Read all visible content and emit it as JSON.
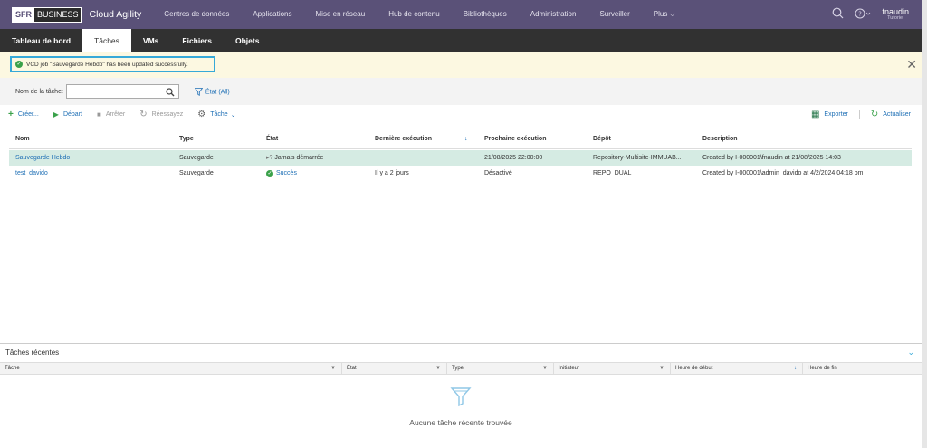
{
  "header": {
    "logo_sfr": "SFR",
    "logo_business": "BUSINESS",
    "app_name": "Cloud Agility",
    "nav": [
      "Centres de données",
      "Applications",
      "Mise en réseau",
      "Hub de contenu",
      "Bibliothèques",
      "Administration",
      "Surveiller",
      "Plus ⌵"
    ],
    "user_name": "fnaudin",
    "user_org": "Tutoriel"
  },
  "tabs": [
    "Tableau de bord",
    "Tâches",
    "VMs",
    "Fichiers",
    "Objets"
  ],
  "notification": {
    "message": "VCD job \"Sauvegarde Hebdo\" has been updated successfully."
  },
  "filter": {
    "label": "Nom de la tâche:",
    "value": "",
    "status": "État (All)"
  },
  "toolbar": {
    "create": "Créer...",
    "start": "Départ",
    "stop": "Arrêter",
    "retry": "Réessayez",
    "task": "Tâche",
    "export": "Exporter",
    "refresh": "Actualiser"
  },
  "table": {
    "headers": [
      "Nom",
      "Type",
      "État",
      "Dernière exécution",
      "Prochaine exécution",
      "Dépôt",
      "Description"
    ],
    "rows": [
      [
        "Sauvegarde Hebdo",
        "Sauvegarde",
        "Jamais démarrée",
        "",
        "21/08/2025 22:00:00",
        "Repository-Multisite-IMMUAB...",
        "Created by I-000001\\fnaudin at 21/08/2025 14:03"
      ],
      [
        "test_davido",
        "Sauvegarde",
        "Succès",
        "Il y a 2 jours",
        "Désactivé",
        "REPO_DUAL",
        "Created by I-000001\\admin_davido at 4/2/2024 04:18 pm"
      ]
    ]
  },
  "recent": {
    "title": "Tâches récentes",
    "columns": [
      "Tâche",
      "État",
      "Type",
      "Initiateur",
      "Heure de début",
      "Heure de fin"
    ],
    "empty_message": "Aucune tâche récente trouvée"
  },
  "colors": {
    "nav_bg": "#5a5178",
    "accent": "#1e6fb5",
    "selected_row": "#d5ebe3",
    "notif_bg": "#fcf8e1",
    "success": "#3aa14a"
  }
}
